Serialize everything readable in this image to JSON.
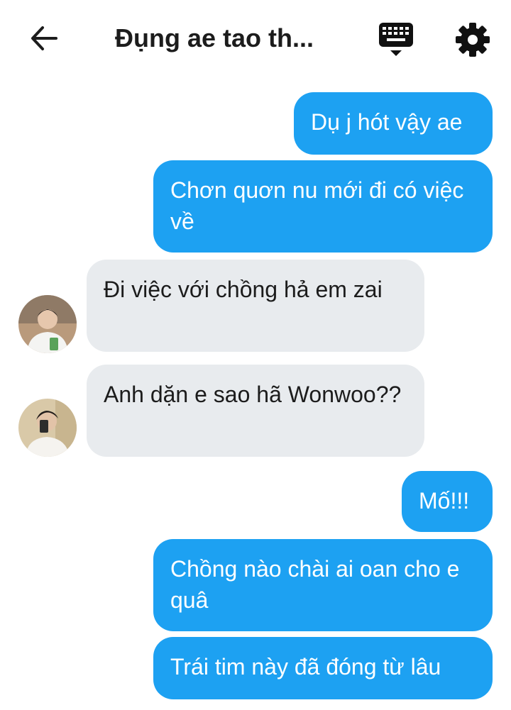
{
  "header": {
    "title": "Đụng ae tao th...",
    "back_icon": "arrow-left-icon",
    "keyboard_icon": "keyboard-icon",
    "settings_icon": "gear-icon"
  },
  "messages": [
    {
      "side": "out",
      "text": "Dụ j hót vậy ae"
    },
    {
      "side": "out",
      "text": "Chơn quơn nu mới đi có việc về"
    },
    {
      "side": "in",
      "avatar": "avatar-1",
      "text": "Đi việc với chồng hả em zai"
    },
    {
      "side": "in",
      "avatar": "avatar-2",
      "text": "Anh dặn e sao hã Wonwoo??"
    },
    {
      "side": "out",
      "text": "Mố!!!"
    },
    {
      "side": "out",
      "text": "Chồng nào chài ai oan cho e quâ"
    },
    {
      "side": "out",
      "text": "Trái tim này đã đóng từ lâu"
    }
  ],
  "colors": {
    "outgoing_bubble": "#1da1f2",
    "incoming_bubble": "#e8ebee",
    "title_text": "#1c1c1c"
  }
}
